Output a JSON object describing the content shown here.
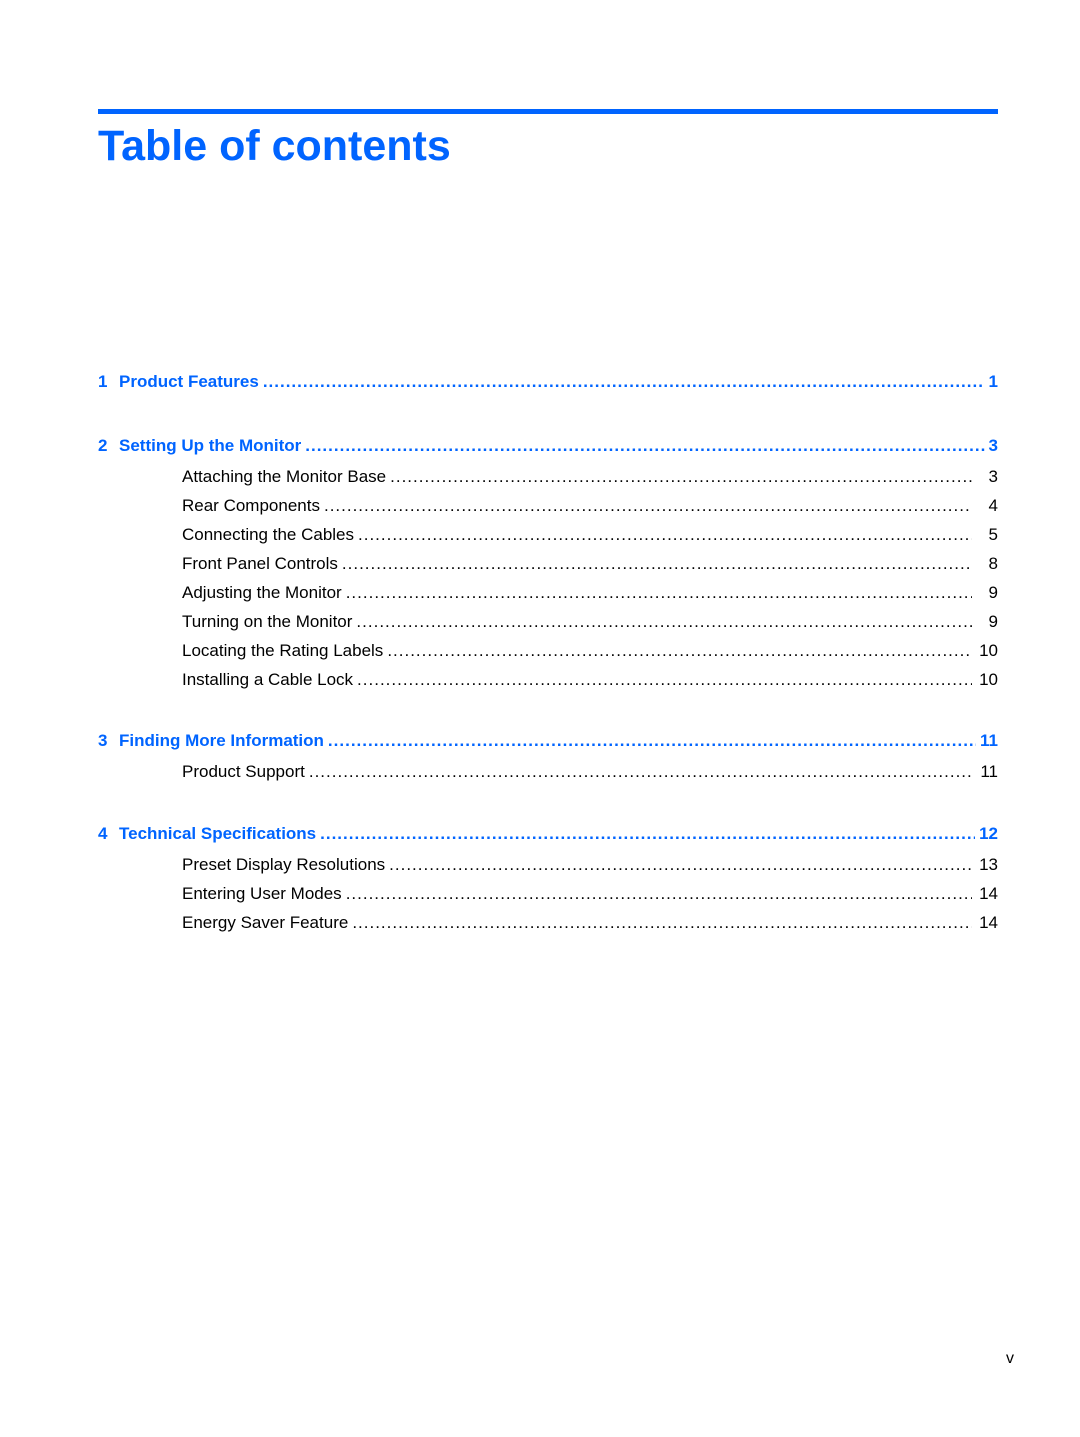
{
  "title": "Table of contents",
  "accent_color": "#0064ff",
  "chapters": [
    {
      "number": "1",
      "label": "Product Features",
      "page": "1",
      "sections": []
    },
    {
      "number": "2",
      "label": "Setting Up the Monitor",
      "page": "3",
      "sections": [
        {
          "label": "Attaching the Monitor Base",
          "page": "3"
        },
        {
          "label": "Rear Components",
          "page": "4"
        },
        {
          "label": "Connecting the Cables",
          "page": "5"
        },
        {
          "label": "Front Panel Controls",
          "page": "8"
        },
        {
          "label": "Adjusting the Monitor",
          "page": "9"
        },
        {
          "label": "Turning on the Monitor",
          "page": "9"
        },
        {
          "label": "Locating the Rating Labels",
          "page": "10"
        },
        {
          "label": "Installing a Cable Lock",
          "page": "10"
        }
      ]
    },
    {
      "number": "3",
      "label": "Finding More Information",
      "page": "11",
      "sections": [
        {
          "label": "Product Support",
          "page": "11"
        }
      ]
    },
    {
      "number": "4",
      "label": "Technical Specifications",
      "page": "12",
      "sections": [
        {
          "label": "Preset Display Resolutions",
          "page": "13"
        },
        {
          "label": "Entering User Modes",
          "page": "14"
        },
        {
          "label": "Energy Saver Feature",
          "page": "14"
        }
      ]
    }
  ],
  "footer": {
    "page_number": "v"
  }
}
